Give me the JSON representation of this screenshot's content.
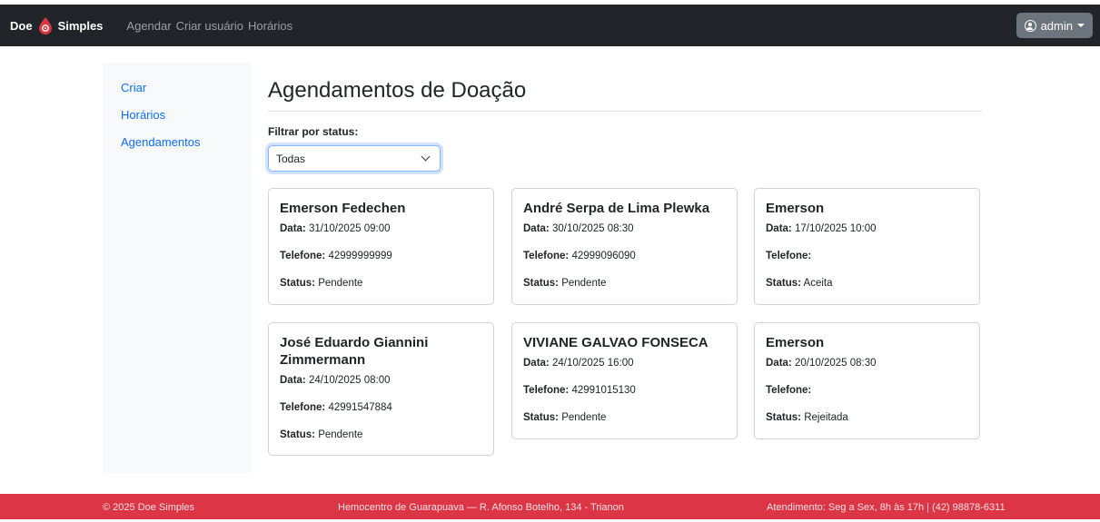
{
  "navbar": {
    "brand_left": "Doe",
    "brand_right": "Simples",
    "links": [
      "Agendar",
      "Criar usuário",
      "Horários"
    ],
    "user_label": "admin"
  },
  "sidebar": {
    "items": [
      "Criar",
      "Horários",
      "Agendamentos"
    ]
  },
  "main": {
    "title": "Agendamentos de Doação",
    "filter_label": "Filtrar por status:",
    "filter_value": "Todas"
  },
  "labels": {
    "data": "Data:",
    "telefone": "Telefone:",
    "status": "Status:"
  },
  "cards": [
    {
      "name": "Emerson Fedechen",
      "data": "31/10/2025 09:00",
      "telefone": "42999999999",
      "status": "Pendente"
    },
    {
      "name": "André Serpa de Lima Plewka",
      "data": "30/10/2025 08:30",
      "telefone": "42999096090",
      "status": "Pendente"
    },
    {
      "name": "Emerson",
      "data": "17/10/2025 10:00",
      "telefone": "",
      "status": "Aceita"
    },
    {
      "name": "José Eduardo Giannini Zimmermann",
      "data": "24/10/2025 08:00",
      "telefone": "42991547884",
      "status": "Pendente"
    },
    {
      "name": "VIVIANE GALVAO FONSECA",
      "data": "24/10/2025 16:00",
      "telefone": "42991015130",
      "status": "Pendente"
    },
    {
      "name": "Emerson",
      "data": "20/10/2025 08:30",
      "telefone": "",
      "status": "Rejeitada"
    }
  ],
  "footer": {
    "copyright": "© 2025 Doe Simples",
    "address": "Hemocentro de Guarapuava — R. Afonso Botelho, 134 - Trianon",
    "hours": "Atendimento: Seg a Sex, 8h às 17h | (42) 98878-6311"
  },
  "colors": {
    "navbar": "#212529",
    "footer": "#dc3545",
    "link": "#0d6efd",
    "brand_drop": "#dc3545"
  }
}
